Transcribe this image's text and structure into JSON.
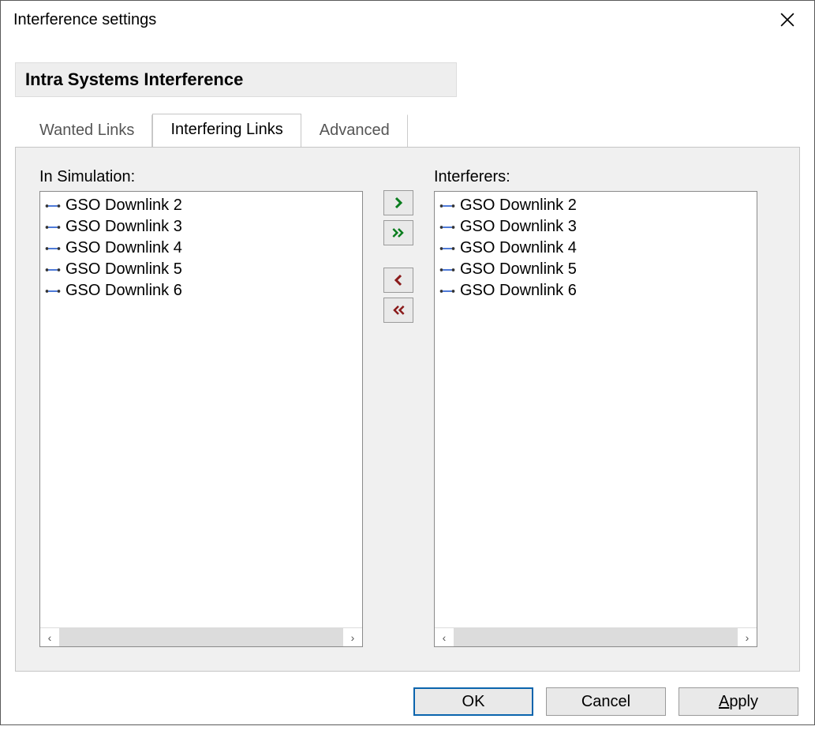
{
  "window": {
    "title": "Interference settings"
  },
  "section": {
    "title": "Intra Systems Interference"
  },
  "tabs": [
    {
      "label": "Wanted Links",
      "active": false
    },
    {
      "label": "Interfering Links",
      "active": true
    },
    {
      "label": "Advanced",
      "active": false
    }
  ],
  "left_list": {
    "label": "In Simulation:",
    "items": [
      "GSO Downlink 2",
      "GSO Downlink 3",
      "GSO Downlink 4",
      "GSO Downlink 5",
      "GSO Downlink 6"
    ]
  },
  "right_list": {
    "label": "Interferers:",
    "items": [
      "GSO Downlink 2",
      "GSO Downlink 3",
      "GSO Downlink 4",
      "GSO Downlink 5",
      "GSO Downlink 6"
    ]
  },
  "buttons": {
    "ok": "OK",
    "cancel": "Cancel",
    "apply_prefix": "A",
    "apply_rest": "pply"
  }
}
